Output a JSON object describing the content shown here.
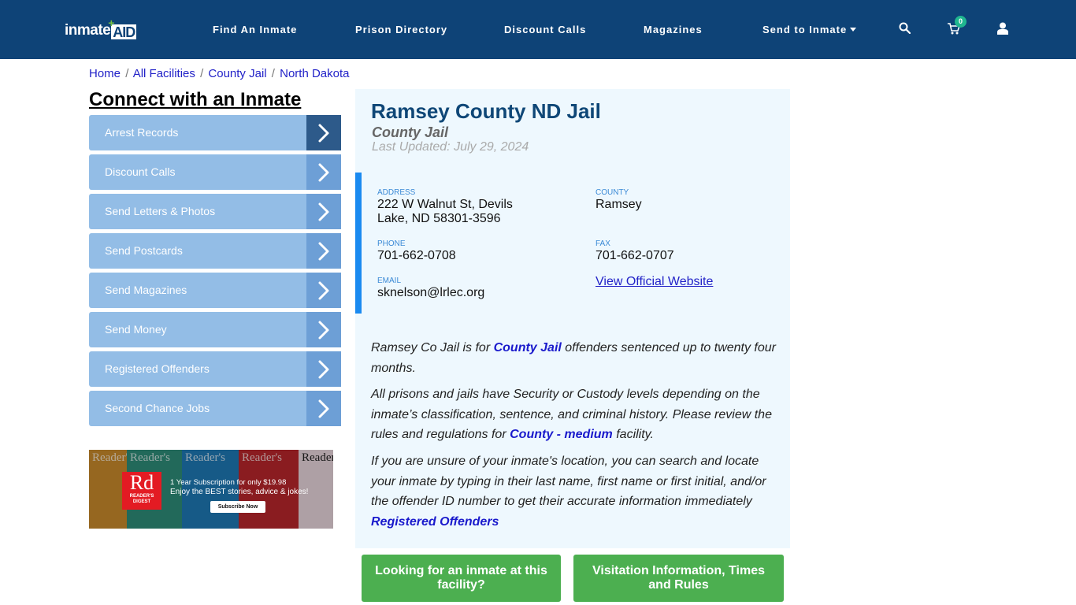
{
  "header": {
    "logo": {
      "part1": "inmate",
      "part2": "AID",
      "plus": "+"
    },
    "nav": [
      {
        "label": "Find An Inmate"
      },
      {
        "label": "Prison Directory"
      },
      {
        "label": "Discount Calls"
      },
      {
        "label": "Magazines"
      },
      {
        "label": "Send to Inmate",
        "has_dropdown": true
      }
    ],
    "icons": {
      "search": "search-icon",
      "cart": "cart-icon",
      "user": "user-icon"
    },
    "cart_count": "0",
    "brand_color": "#0e4377"
  },
  "breadcrumb": [
    {
      "label": "Home"
    },
    {
      "label": "All Facilities"
    },
    {
      "label": "County Jail"
    },
    {
      "label": "North Dakota"
    }
  ],
  "breadcrumb_separator": "/",
  "sidebar": {
    "title": "Connect with an Inmate",
    "items": [
      {
        "label": "Arrest Records"
      },
      {
        "label": "Discount Calls"
      },
      {
        "label": "Send Letters & Photos"
      },
      {
        "label": "Send Postcards"
      },
      {
        "label": "Send Magazines"
      },
      {
        "label": "Send Money"
      },
      {
        "label": "Registered Offenders"
      },
      {
        "label": "Second Chance Jobs"
      }
    ],
    "ad": {
      "logo_big": "Rd",
      "logo_small": "READER'S DIGEST",
      "line1": "1 Year Subscription for only $19.98",
      "line2": "Enjoy the BEST stories, advice & jokes!",
      "cta": "Subscribe Now",
      "cover_title": "Reader's"
    }
  },
  "facility": {
    "name": "Ramsey County ND Jail",
    "type": "County Jail",
    "last_updated": "Last Updated: July 29, 2024",
    "address_label": "ADDRESS",
    "address_line1": "222 W Walnut St, Devils",
    "address_line2": "Lake, ND 58301-3596",
    "county_label": "COUNTY",
    "county": "Ramsey",
    "phone_label": "PHONE",
    "phone": "701-662-0708",
    "fax_label": "FAX",
    "fax": "701-662-0707",
    "email_label": "EMAIL",
    "email": "sknelson@lrlec.org",
    "website_link": "View Official Website"
  },
  "description": {
    "p1_a": "Ramsey Co Jail is for ",
    "p1_link": "County Jail",
    "p1_b": " offenders sentenced up to twenty four months.",
    "p2_a": "All prisons and jails have Security or Custody levels depending on the inmate’s classification, sentence, and criminal history. Please review the rules and regulations for ",
    "p2_link": "County - medium",
    "p2_b": " facility.",
    "p3": "If you are unsure of your inmate's location, you can search and locate your inmate by typing in their last name, first name or first initial, and/or the offender ID number to get their accurate information immediately",
    "p3_link": "Registered Offenders"
  },
  "buttons": {
    "find_inmate": "Looking for an inmate at this facility?",
    "visitation": "Visitation Information, Times and Rules",
    "color": "#4caf50"
  }
}
